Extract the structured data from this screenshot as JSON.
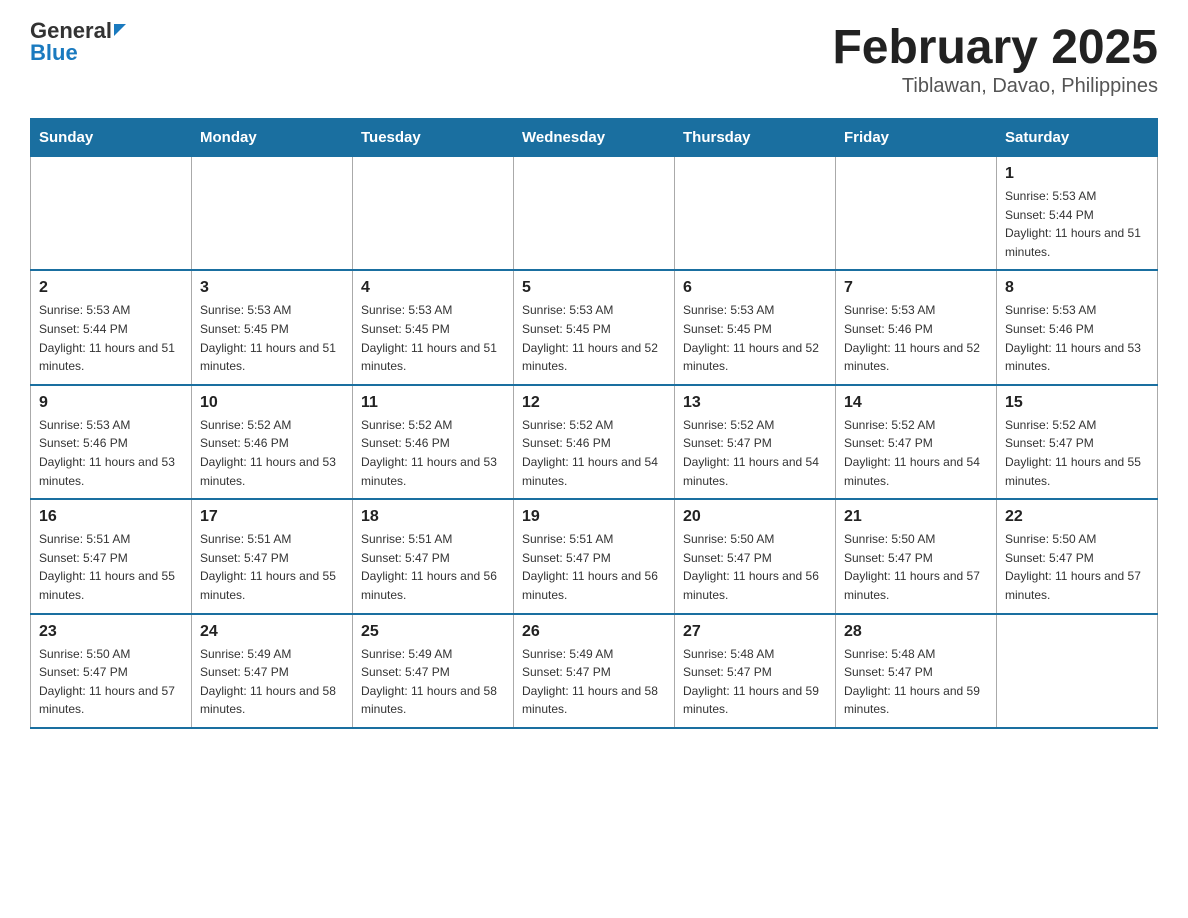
{
  "header": {
    "logo_text1": "General",
    "logo_text2": "Blue",
    "month_title": "February 2025",
    "location": "Tiblawan, Davao, Philippines"
  },
  "weekdays": [
    "Sunday",
    "Monday",
    "Tuesday",
    "Wednesday",
    "Thursday",
    "Friday",
    "Saturday"
  ],
  "weeks": [
    [
      {
        "day": "",
        "info": ""
      },
      {
        "day": "",
        "info": ""
      },
      {
        "day": "",
        "info": ""
      },
      {
        "day": "",
        "info": ""
      },
      {
        "day": "",
        "info": ""
      },
      {
        "day": "",
        "info": ""
      },
      {
        "day": "1",
        "info": "Sunrise: 5:53 AM\nSunset: 5:44 PM\nDaylight: 11 hours and 51 minutes."
      }
    ],
    [
      {
        "day": "2",
        "info": "Sunrise: 5:53 AM\nSunset: 5:44 PM\nDaylight: 11 hours and 51 minutes."
      },
      {
        "day": "3",
        "info": "Sunrise: 5:53 AM\nSunset: 5:45 PM\nDaylight: 11 hours and 51 minutes."
      },
      {
        "day": "4",
        "info": "Sunrise: 5:53 AM\nSunset: 5:45 PM\nDaylight: 11 hours and 51 minutes."
      },
      {
        "day": "5",
        "info": "Sunrise: 5:53 AM\nSunset: 5:45 PM\nDaylight: 11 hours and 52 minutes."
      },
      {
        "day": "6",
        "info": "Sunrise: 5:53 AM\nSunset: 5:45 PM\nDaylight: 11 hours and 52 minutes."
      },
      {
        "day": "7",
        "info": "Sunrise: 5:53 AM\nSunset: 5:46 PM\nDaylight: 11 hours and 52 minutes."
      },
      {
        "day": "8",
        "info": "Sunrise: 5:53 AM\nSunset: 5:46 PM\nDaylight: 11 hours and 53 minutes."
      }
    ],
    [
      {
        "day": "9",
        "info": "Sunrise: 5:53 AM\nSunset: 5:46 PM\nDaylight: 11 hours and 53 minutes."
      },
      {
        "day": "10",
        "info": "Sunrise: 5:52 AM\nSunset: 5:46 PM\nDaylight: 11 hours and 53 minutes."
      },
      {
        "day": "11",
        "info": "Sunrise: 5:52 AM\nSunset: 5:46 PM\nDaylight: 11 hours and 53 minutes."
      },
      {
        "day": "12",
        "info": "Sunrise: 5:52 AM\nSunset: 5:46 PM\nDaylight: 11 hours and 54 minutes."
      },
      {
        "day": "13",
        "info": "Sunrise: 5:52 AM\nSunset: 5:47 PM\nDaylight: 11 hours and 54 minutes."
      },
      {
        "day": "14",
        "info": "Sunrise: 5:52 AM\nSunset: 5:47 PM\nDaylight: 11 hours and 54 minutes."
      },
      {
        "day": "15",
        "info": "Sunrise: 5:52 AM\nSunset: 5:47 PM\nDaylight: 11 hours and 55 minutes."
      }
    ],
    [
      {
        "day": "16",
        "info": "Sunrise: 5:51 AM\nSunset: 5:47 PM\nDaylight: 11 hours and 55 minutes."
      },
      {
        "day": "17",
        "info": "Sunrise: 5:51 AM\nSunset: 5:47 PM\nDaylight: 11 hours and 55 minutes."
      },
      {
        "day": "18",
        "info": "Sunrise: 5:51 AM\nSunset: 5:47 PM\nDaylight: 11 hours and 56 minutes."
      },
      {
        "day": "19",
        "info": "Sunrise: 5:51 AM\nSunset: 5:47 PM\nDaylight: 11 hours and 56 minutes."
      },
      {
        "day": "20",
        "info": "Sunrise: 5:50 AM\nSunset: 5:47 PM\nDaylight: 11 hours and 56 minutes."
      },
      {
        "day": "21",
        "info": "Sunrise: 5:50 AM\nSunset: 5:47 PM\nDaylight: 11 hours and 57 minutes."
      },
      {
        "day": "22",
        "info": "Sunrise: 5:50 AM\nSunset: 5:47 PM\nDaylight: 11 hours and 57 minutes."
      }
    ],
    [
      {
        "day": "23",
        "info": "Sunrise: 5:50 AM\nSunset: 5:47 PM\nDaylight: 11 hours and 57 minutes."
      },
      {
        "day": "24",
        "info": "Sunrise: 5:49 AM\nSunset: 5:47 PM\nDaylight: 11 hours and 58 minutes."
      },
      {
        "day": "25",
        "info": "Sunrise: 5:49 AM\nSunset: 5:47 PM\nDaylight: 11 hours and 58 minutes."
      },
      {
        "day": "26",
        "info": "Sunrise: 5:49 AM\nSunset: 5:47 PM\nDaylight: 11 hours and 58 minutes."
      },
      {
        "day": "27",
        "info": "Sunrise: 5:48 AM\nSunset: 5:47 PM\nDaylight: 11 hours and 59 minutes."
      },
      {
        "day": "28",
        "info": "Sunrise: 5:48 AM\nSunset: 5:47 PM\nDaylight: 11 hours and 59 minutes."
      },
      {
        "day": "",
        "info": ""
      }
    ]
  ]
}
